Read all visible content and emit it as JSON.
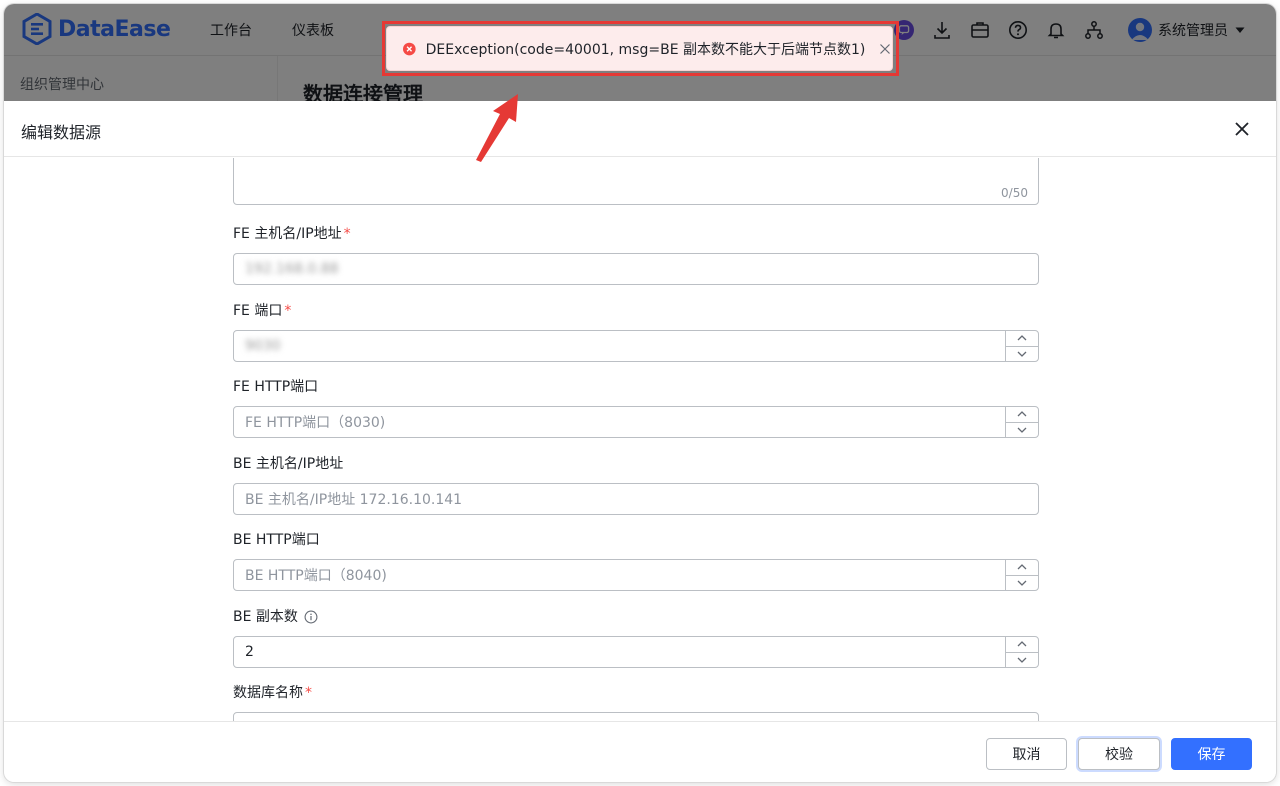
{
  "app": {
    "logo_text": "DataEase",
    "nav": [
      "工作台",
      "仪表板"
    ],
    "user_name": "系统管理员"
  },
  "background": {
    "side_title": "组织管理中心",
    "page_title": "数据连接管理"
  },
  "toast": {
    "message": "DEException(code=40001, msg=BE 副本数不能大于后端节点数1)"
  },
  "drawer": {
    "title": "编辑数据源",
    "textarea_count": "0/50",
    "fields": {
      "fe_host": {
        "label": "FE 主机名/IP地址",
        "value": "192.168.0.88"
      },
      "fe_port": {
        "label": "FE 端口",
        "value": "9030"
      },
      "fe_http_port": {
        "label": "FE HTTP端口",
        "placeholder": "FE HTTP端口（8030)"
      },
      "be_host": {
        "label": "BE 主机名/IP地址",
        "placeholder": "BE 主机名/IP地址 172.16.10.141"
      },
      "be_http_port": {
        "label": "BE HTTP端口",
        "placeholder": "BE HTTP端口（8040)"
      },
      "be_replicas": {
        "label": "BE 副本数",
        "value": "2"
      },
      "db_name": {
        "label": "数据库名称"
      }
    },
    "footer": {
      "cancel": "取消",
      "check": "校验",
      "save": "保存"
    }
  },
  "colors": {
    "primary": "#3370ff",
    "error": "#f54a45",
    "annotation": "#e53935"
  }
}
